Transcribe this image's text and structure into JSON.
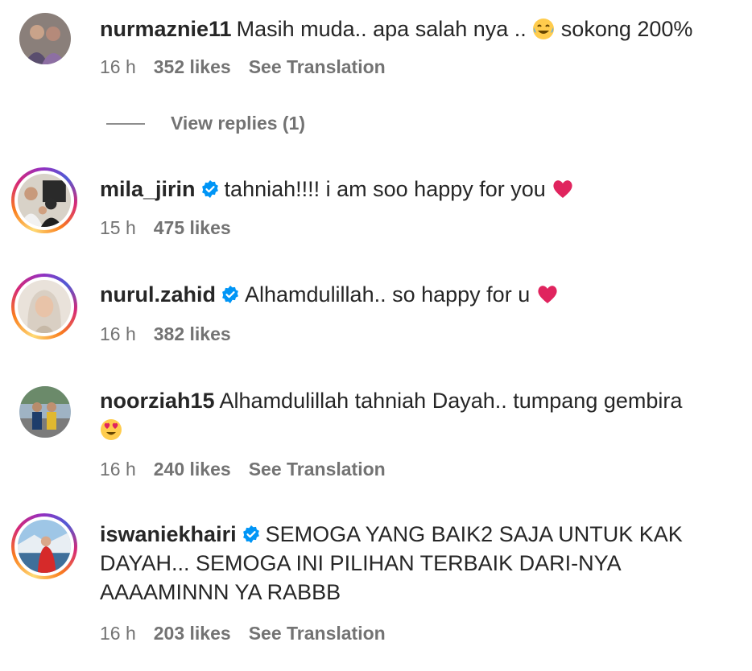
{
  "comments": [
    {
      "username": "nurmaznie11",
      "verified": false,
      "text_before": "Masih muda.. apa salah nya .. ",
      "text_after": " sokong 200%",
      "emoji": "😂",
      "time": "16 h",
      "likes": "352 likes",
      "translate": "See Translation",
      "replies": "View replies (1)"
    },
    {
      "username": "mila_jirin",
      "verified": true,
      "text_before": "tahniah!!!! i am soo happy for you ",
      "emoji": "❤️",
      "time": "15 h",
      "likes": "475 likes"
    },
    {
      "username": "nurul.zahid",
      "verified": true,
      "text_before": "Alhamdulillah.. so happy for u ",
      "emoji": "❤️",
      "time": "16 h",
      "likes": "382 likes"
    },
    {
      "username": "noorziah15",
      "verified": false,
      "text_before": "Alhamdulillah tahniah Dayah.. tumpang gembira ",
      "emoji": "😍",
      "time": "16 h",
      "likes": "240 likes",
      "translate": "See Translation"
    },
    {
      "username": "iswaniekhairi",
      "verified": true,
      "text_before": "SEMOGA YANG BAIK2 SAJA UNTUK KAK DAYAH... SEMOGA INI PILIHAN TERBAIK DARI-NYA AAAAMINNN YA RABBB",
      "time": "16 h",
      "likes": "203 likes",
      "translate": "See Translation"
    }
  ],
  "colors": {
    "text": "#262626",
    "meta": "#737373",
    "verified": "#0095f6",
    "heart": "#e0245e"
  }
}
